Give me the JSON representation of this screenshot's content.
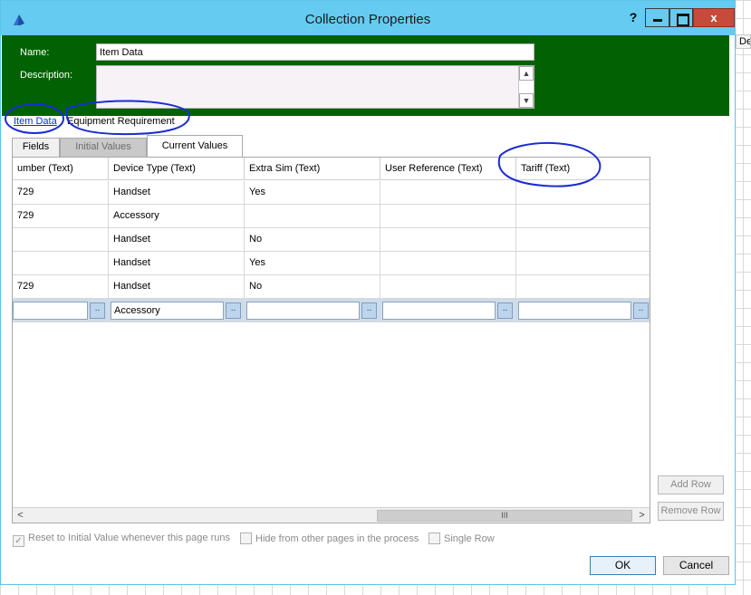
{
  "background": {
    "partial_header": "De"
  },
  "window": {
    "title": "Collection Properties",
    "help": "?",
    "close": "x"
  },
  "form": {
    "name_label": "Name:",
    "name_value": "Item Data",
    "description_label": "Description:",
    "description_value": ""
  },
  "collection_tabs": {
    "item_data": "Item Data",
    "equipment": "Equipment Requirement"
  },
  "tabs": {
    "fields": "Fields",
    "initial": "Initial Values",
    "current": "Current Values"
  },
  "columns": [
    "umber  (Text)",
    "Device Type  (Text)",
    "Extra Sim  (Text)",
    "User Reference  (Text)",
    "Tariff  (Text)"
  ],
  "rows": [
    [
      "729",
      "Handset",
      "Yes",
      "",
      ""
    ],
    [
      "729",
      "Accessory",
      "",
      "",
      ""
    ],
    [
      "",
      "Handset",
      "No",
      "",
      ""
    ],
    [
      "",
      "Handset",
      "Yes",
      "",
      ""
    ],
    [
      "729",
      "Handset",
      "No",
      "",
      ""
    ]
  ],
  "edit_row": [
    "",
    "Accessory",
    "",
    "",
    ""
  ],
  "ellipsis": "..",
  "scrollbar": {
    "left": "<",
    "right": ">",
    "grip": "III"
  },
  "side_buttons": {
    "add_row": "Add Row",
    "remove_row": "Remove Row"
  },
  "checkboxes": {
    "reset": "Reset to Initial Value whenever this page runs",
    "hide": "Hide from other pages in the process",
    "single": "Single Row",
    "check": "✓"
  },
  "buttons": {
    "ok": "OK",
    "cancel": "Cancel"
  },
  "colors": {
    "title_bar": "#65cbf1",
    "panel": "#006200",
    "close": "#c74b3a",
    "annotation": "#1a2bd6"
  }
}
